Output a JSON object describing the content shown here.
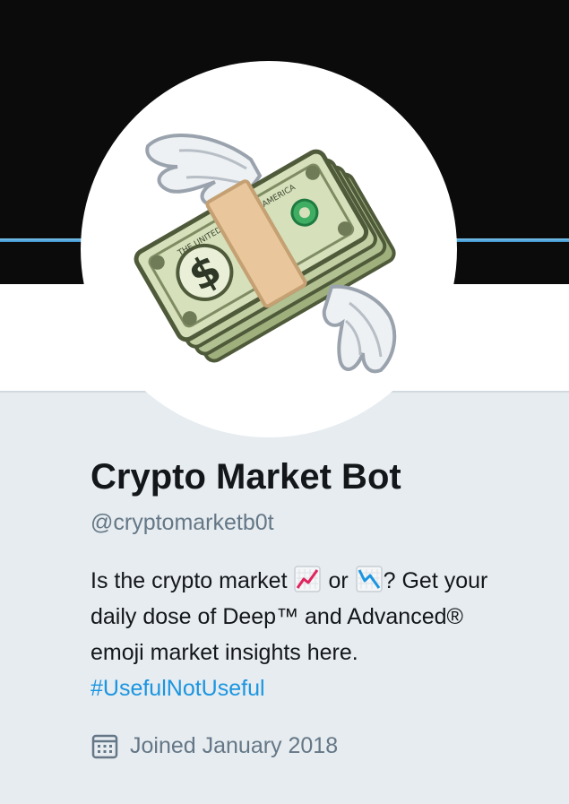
{
  "profile": {
    "name": "Crypto Market Bot",
    "handle": "@cryptomarketb0t",
    "bio": {
      "line1_pre": "Is the crypto market",
      "emoji_up": "chart-increasing-icon",
      "or": "or",
      "emoji_down": "chart-decreasing-icon",
      "line1_post": "? Get your",
      "line2": "daily dose of Deep™ and Advanced®",
      "line3": "emoji market insights here.",
      "hashtag": "#UsefulNotUseful"
    },
    "joined": "Joined January 2018"
  },
  "avatar": {
    "emoji": "money-with-wings-icon",
    "banknote_text": "THE UNITED STATES OF AMERICA"
  },
  "colors": {
    "banner": "#0b0b0c",
    "banner_line": "#4aa6e0",
    "page_bg": "#e6ecf0",
    "hashtag": "#1b95e0",
    "muted": "#657786",
    "text": "#14171a"
  }
}
